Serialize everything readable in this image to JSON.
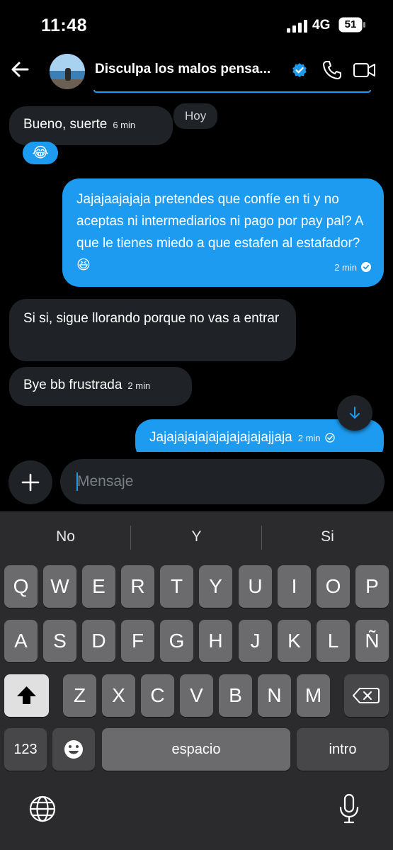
{
  "status": {
    "time": "11:48",
    "network": "4G",
    "battery": "51"
  },
  "header": {
    "title": "Disculpa los malos pensa...",
    "verified": true
  },
  "chat": {
    "day_label": "Hoy",
    "messages": [
      {
        "dir": "in",
        "text": "Bueno, suerte",
        "time": "6 min",
        "reaction": "😂"
      },
      {
        "dir": "out",
        "text": "Jajajaajajaja pretendes que confíe en ti y no aceptas ni intermediarios ni pago por pay pal? A que le tienes miedo a que estafen al estafador? 😆",
        "time": "2 min"
      },
      {
        "dir": "in",
        "text": "Si si, sigue llorando porque no vas a entrar",
        "time": ""
      },
      {
        "dir": "in",
        "text": "Bye bb frustrada",
        "time": "2 min"
      },
      {
        "dir": "out",
        "text": "Jajajajajajajajajajajajjaja",
        "time": "2 min"
      }
    ]
  },
  "composer": {
    "placeholder": "Mensaje"
  },
  "keyboard": {
    "suggestions": [
      "No",
      "Y",
      "Si"
    ],
    "row1": [
      "Q",
      "W",
      "E",
      "R",
      "T",
      "Y",
      "U",
      "I",
      "O",
      "P"
    ],
    "row2": [
      "A",
      "S",
      "D",
      "F",
      "G",
      "H",
      "J",
      "K",
      "L",
      "Ñ"
    ],
    "row3": [
      "Z",
      "X",
      "C",
      "V",
      "B",
      "N",
      "M"
    ],
    "numbers_label": "123",
    "space_label": "espacio",
    "return_label": "intro"
  },
  "colors": {
    "accent": "#1d9bf0",
    "bubble_in": "#1f2226",
    "keyboard_bg": "#2b2b2d",
    "key": "#6b6b6e"
  },
  "icons": [
    "back-arrow-icon",
    "verified-badge-icon",
    "phone-icon",
    "video-icon",
    "plus-icon",
    "arrow-down-icon",
    "shift-icon",
    "backspace-icon",
    "emoji-icon",
    "globe-icon",
    "microphone-icon",
    "read-check-icon"
  ]
}
